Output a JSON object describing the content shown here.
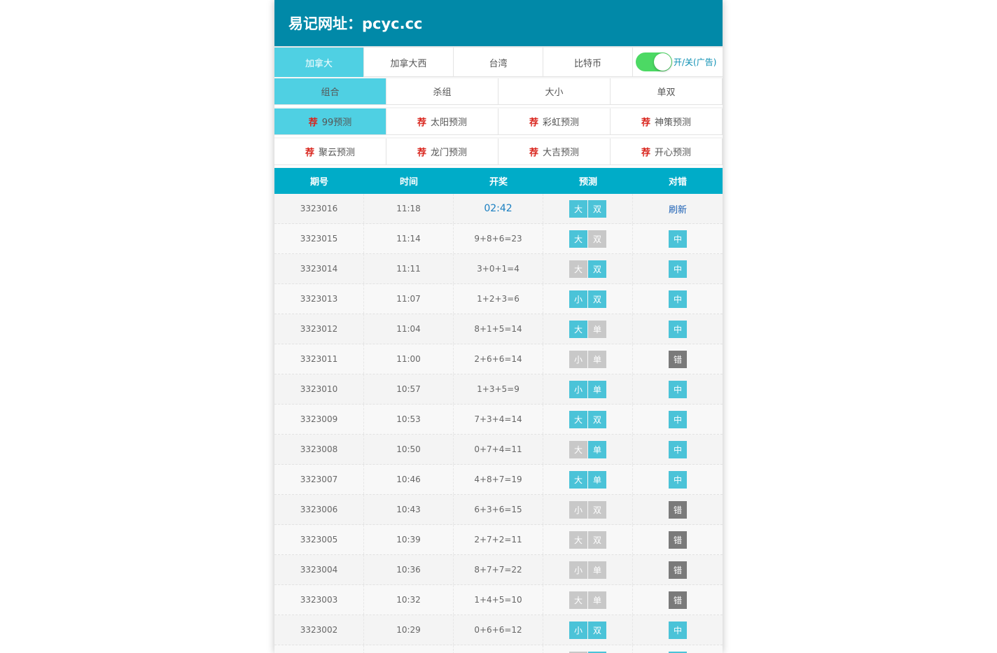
{
  "header": {
    "title": "易记网址：pcyc.cc"
  },
  "tabs1": [
    {
      "label": "加拿大",
      "active": true
    },
    {
      "label": "加拿大西",
      "active": false
    },
    {
      "label": "台湾",
      "active": false
    },
    {
      "label": "比特币",
      "active": false
    }
  ],
  "toggle": {
    "label": "开/关(广告)",
    "on": true
  },
  "tabs2": [
    {
      "label": "组合",
      "active": true
    },
    {
      "label": "杀组",
      "active": false
    },
    {
      "label": "大小",
      "active": false
    },
    {
      "label": "单双",
      "active": false
    }
  ],
  "predictors": {
    "rec_mark": "荐",
    "row1": [
      {
        "label": "99预测",
        "active": true
      },
      {
        "label": "太阳预测",
        "active": false
      },
      {
        "label": "彩虹预测",
        "active": false
      },
      {
        "label": "神策预测",
        "active": false
      }
    ],
    "row2": [
      {
        "label": "聚云预测",
        "active": false
      },
      {
        "label": "龙门预测",
        "active": false
      },
      {
        "label": "大吉预测",
        "active": false
      },
      {
        "label": "开心预测",
        "active": false
      }
    ]
  },
  "table": {
    "headers": [
      "期号",
      "时间",
      "开奖",
      "预测",
      "对错"
    ],
    "current": {
      "issue": "3323016",
      "time": "11:18",
      "countdown": "02:42",
      "pred": [
        "大",
        "双"
      ],
      "pred_hit": [
        true,
        true
      ],
      "action": "刷新"
    },
    "rows": [
      {
        "issue": "3323015",
        "time": "11:14",
        "draw": "9+8+6=23",
        "pred": [
          "大",
          "双"
        ],
        "pred_hit": [
          true,
          false
        ],
        "result": "中"
      },
      {
        "issue": "3323014",
        "time": "11:11",
        "draw": "3+0+1=4",
        "pred": [
          "大",
          "双"
        ],
        "pred_hit": [
          false,
          true
        ],
        "result": "中"
      },
      {
        "issue": "3323013",
        "time": "11:07",
        "draw": "1+2+3=6",
        "pred": [
          "小",
          "双"
        ],
        "pred_hit": [
          true,
          true
        ],
        "result": "中"
      },
      {
        "issue": "3323012",
        "time": "11:04",
        "draw": "8+1+5=14",
        "pred": [
          "大",
          "单"
        ],
        "pred_hit": [
          true,
          false
        ],
        "result": "中"
      },
      {
        "issue": "3323011",
        "time": "11:00",
        "draw": "2+6+6=14",
        "pred": [
          "小",
          "单"
        ],
        "pred_hit": [
          false,
          false
        ],
        "result": "错"
      },
      {
        "issue": "3323010",
        "time": "10:57",
        "draw": "1+3+5=9",
        "pred": [
          "小",
          "单"
        ],
        "pred_hit": [
          true,
          true
        ],
        "result": "中"
      },
      {
        "issue": "3323009",
        "time": "10:53",
        "draw": "7+3+4=14",
        "pred": [
          "大",
          "双"
        ],
        "pred_hit": [
          true,
          true
        ],
        "result": "中"
      },
      {
        "issue": "3323008",
        "time": "10:50",
        "draw": "0+7+4=11",
        "pred": [
          "大",
          "单"
        ],
        "pred_hit": [
          false,
          true
        ],
        "result": "中"
      },
      {
        "issue": "3323007",
        "time": "10:46",
        "draw": "4+8+7=19",
        "pred": [
          "大",
          "单"
        ],
        "pred_hit": [
          true,
          true
        ],
        "result": "中"
      },
      {
        "issue": "3323006",
        "time": "10:43",
        "draw": "6+3+6=15",
        "pred": [
          "小",
          "双"
        ],
        "pred_hit": [
          false,
          false
        ],
        "result": "错"
      },
      {
        "issue": "3323005",
        "time": "10:39",
        "draw": "2+7+2=11",
        "pred": [
          "大",
          "双"
        ],
        "pred_hit": [
          false,
          false
        ],
        "result": "错"
      },
      {
        "issue": "3323004",
        "time": "10:36",
        "draw": "8+7+7=22",
        "pred": [
          "小",
          "单"
        ],
        "pred_hit": [
          false,
          false
        ],
        "result": "错"
      },
      {
        "issue": "3323003",
        "time": "10:32",
        "draw": "1+4+5=10",
        "pred": [
          "大",
          "单"
        ],
        "pred_hit": [
          false,
          false
        ],
        "result": "错"
      },
      {
        "issue": "3323002",
        "time": "10:29",
        "draw": "0+6+6=12",
        "pred": [
          "小",
          "双"
        ],
        "pred_hit": [
          true,
          true
        ],
        "result": "中"
      },
      {
        "issue": "",
        "time": "",
        "draw": "",
        "pred": [
          "",
          ""
        ],
        "pred_hit": [
          false,
          true
        ],
        "result": ""
      }
    ]
  },
  "colors": {
    "header_bg": "#0189a8",
    "table_head_bg": "#00acc8",
    "active_tab": "#4fd0e3",
    "hit": "#4bc3d8",
    "off": "#c8c8c8",
    "miss": "#7a7a7a",
    "toggle_on": "#4cd964"
  }
}
